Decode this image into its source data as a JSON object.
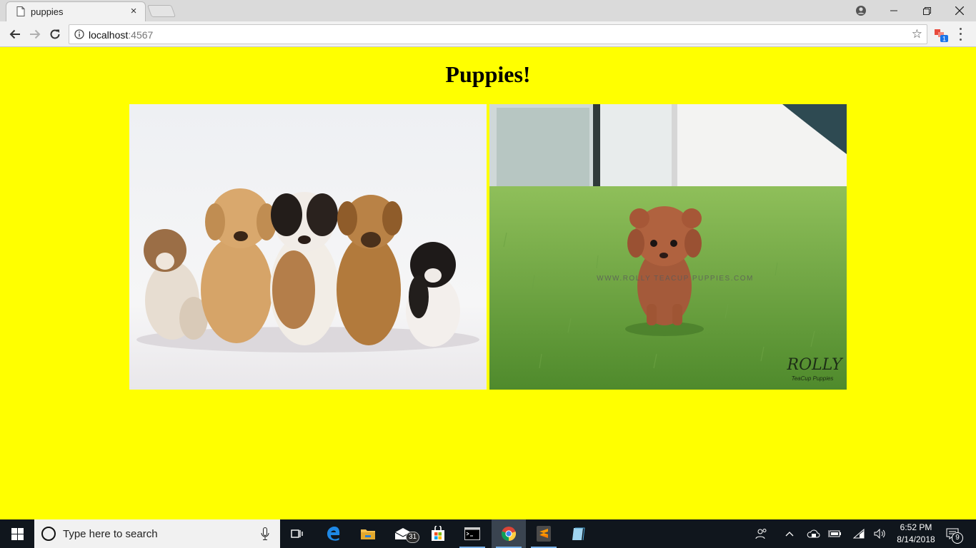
{
  "browser": {
    "tab_title": "puppies",
    "tab_close": "×",
    "url_host": "localhost",
    "url_port": ":4567",
    "bookmark_star": "☆",
    "extension_badge": "1"
  },
  "page": {
    "heading": "Puppies!",
    "background_color": "#ffff00",
    "images": [
      {
        "name": "five-puppies-photo"
      },
      {
        "name": "poodle-on-grass-photo",
        "watermark": "WWW.ROLLY TEACUP PUPPIES.COM",
        "logo_text": "ROLLY",
        "logo_sub": "TeaCup Puppies"
      }
    ]
  },
  "taskbar": {
    "search_placeholder": "Type here to search",
    "mail_badge": "31",
    "time": "6:52 PM",
    "date": "8/14/2018",
    "notification_count": "9"
  }
}
